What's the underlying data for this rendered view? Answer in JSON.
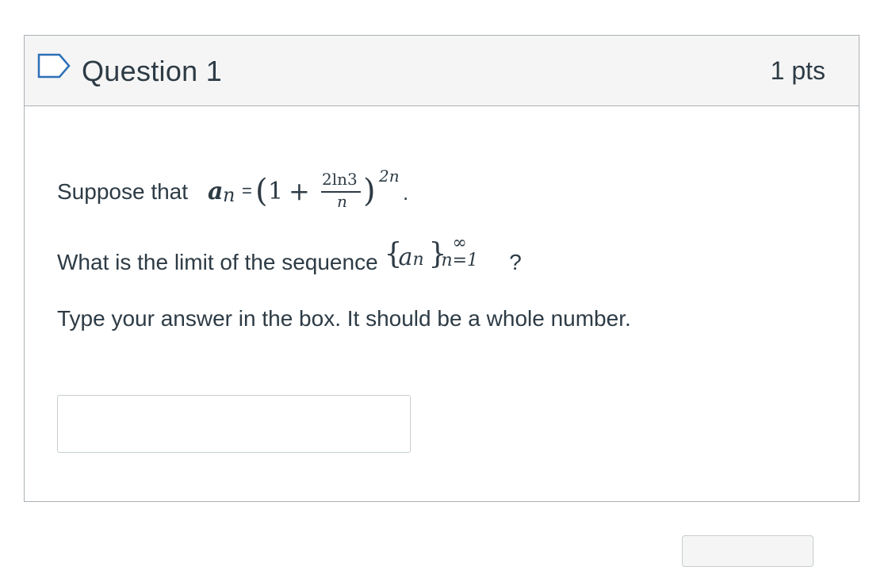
{
  "question": {
    "title": "Question 1",
    "points": "1 pts",
    "flag_icon": "flag-outline-icon"
  },
  "body": {
    "line1_prefix": "Suppose that ",
    "line1_a": "a",
    "line1_n": "n",
    "line1_eq": "=",
    "line1_open": "(",
    "line1_one": "1",
    "line1_plus": "+",
    "line1_num": "2ln3",
    "line1_den": "n",
    "line1_close": ")",
    "line1_exp": "2n",
    "line1_period": ".",
    "line2_prefix": "What is the limit of the sequence ",
    "line2_open_brace": "{",
    "line2_a": "a",
    "line2_n": "n",
    "line2_close_brace": "}",
    "line2_sup": "∞",
    "line2_sub": "n=1",
    "line2_suffix": " ?",
    "line3": "Type your answer in the box. It should be a whole number."
  },
  "answer": {
    "value": "",
    "placeholder": ""
  }
}
